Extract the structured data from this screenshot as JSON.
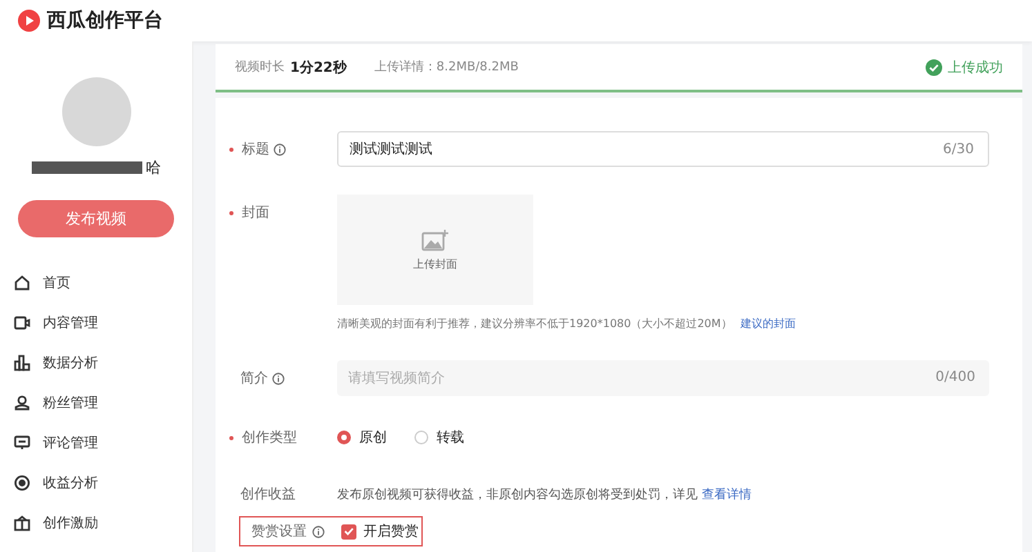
{
  "header": {
    "logo_text": "西瓜创作平台"
  },
  "sidebar": {
    "username_tail": "哈",
    "publish_button": "发布视频",
    "items": [
      {
        "label": "首页",
        "kind": "home",
        "selected": false
      },
      {
        "label": "内容管理",
        "kind": "content",
        "selected": false
      },
      {
        "label": "数据分析",
        "kind": "chart",
        "selected": false
      },
      {
        "label": "粉丝管理",
        "kind": "user",
        "selected": false
      },
      {
        "label": "评论管理",
        "kind": "comment",
        "selected": false
      },
      {
        "label": "收益分析",
        "kind": "coin",
        "selected": false
      },
      {
        "label": "创作激励",
        "kind": "gift",
        "selected": false
      }
    ]
  },
  "upload": {
    "duration_label": "视频时长",
    "duration": "1分22秒",
    "detail_label": "上传详情：",
    "detail": "8.2MB/8.2MB",
    "status": "上传成功"
  },
  "form": {
    "title": {
      "label": "标题",
      "required": true,
      "value": "测试测试测试",
      "count": "6/30"
    },
    "cover": {
      "label": "封面",
      "required": true,
      "upload_text": "上传封面",
      "hint": "清晰美观的封面有利于推荐，建议分辨率不低于1920*1080（大小不超过20M）",
      "hint_link": "建议的封面"
    },
    "intro": {
      "label": "简介",
      "required": false,
      "placeholder": "请填写视频简介",
      "count": "0/400"
    },
    "type": {
      "label": "创作类型",
      "required": true,
      "options": [
        {
          "label": "原创",
          "selected": true
        },
        {
          "label": "转载",
          "selected": false
        }
      ]
    },
    "earnings": {
      "label": "创作收益",
      "required": false,
      "text": "发布原创视频可获得收益，非原创内容勾选原创将受到处罚，详见",
      "link": "查看详情"
    },
    "reward": {
      "label": "赞赏设置",
      "checkbox_label": "开启赞赏",
      "checked": true
    }
  }
}
